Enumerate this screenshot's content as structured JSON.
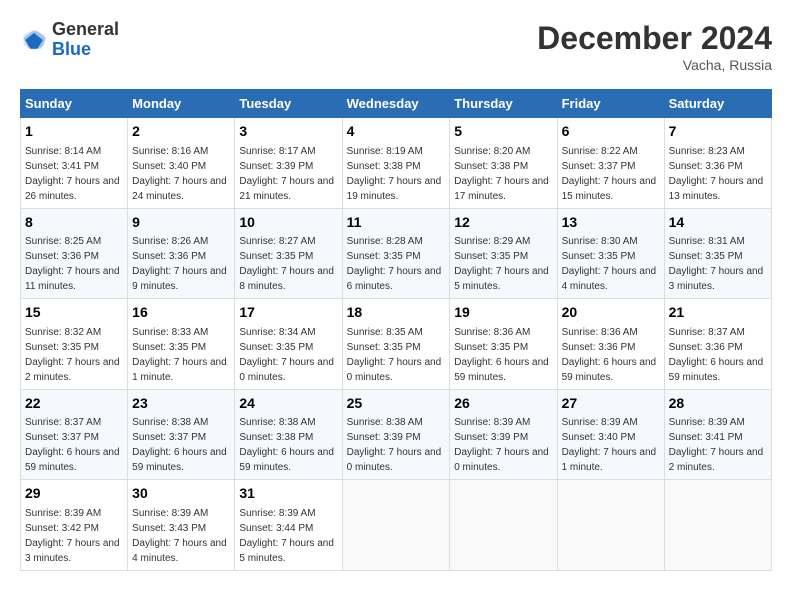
{
  "header": {
    "logo_general": "General",
    "logo_blue": "Blue",
    "month_title": "December 2024",
    "location": "Vacha, Russia"
  },
  "weekdays": [
    "Sunday",
    "Monday",
    "Tuesday",
    "Wednesday",
    "Thursday",
    "Friday",
    "Saturday"
  ],
  "weeks": [
    [
      {
        "day": "1",
        "sunrise": "Sunrise: 8:14 AM",
        "sunset": "Sunset: 3:41 PM",
        "daylight": "Daylight: 7 hours and 26 minutes."
      },
      {
        "day": "2",
        "sunrise": "Sunrise: 8:16 AM",
        "sunset": "Sunset: 3:40 PM",
        "daylight": "Daylight: 7 hours and 24 minutes."
      },
      {
        "day": "3",
        "sunrise": "Sunrise: 8:17 AM",
        "sunset": "Sunset: 3:39 PM",
        "daylight": "Daylight: 7 hours and 21 minutes."
      },
      {
        "day": "4",
        "sunrise": "Sunrise: 8:19 AM",
        "sunset": "Sunset: 3:38 PM",
        "daylight": "Daylight: 7 hours and 19 minutes."
      },
      {
        "day": "5",
        "sunrise": "Sunrise: 8:20 AM",
        "sunset": "Sunset: 3:38 PM",
        "daylight": "Daylight: 7 hours and 17 minutes."
      },
      {
        "day": "6",
        "sunrise": "Sunrise: 8:22 AM",
        "sunset": "Sunset: 3:37 PM",
        "daylight": "Daylight: 7 hours and 15 minutes."
      },
      {
        "day": "7",
        "sunrise": "Sunrise: 8:23 AM",
        "sunset": "Sunset: 3:36 PM",
        "daylight": "Daylight: 7 hours and 13 minutes."
      }
    ],
    [
      {
        "day": "8",
        "sunrise": "Sunrise: 8:25 AM",
        "sunset": "Sunset: 3:36 PM",
        "daylight": "Daylight: 7 hours and 11 minutes."
      },
      {
        "day": "9",
        "sunrise": "Sunrise: 8:26 AM",
        "sunset": "Sunset: 3:36 PM",
        "daylight": "Daylight: 7 hours and 9 minutes."
      },
      {
        "day": "10",
        "sunrise": "Sunrise: 8:27 AM",
        "sunset": "Sunset: 3:35 PM",
        "daylight": "Daylight: 7 hours and 8 minutes."
      },
      {
        "day": "11",
        "sunrise": "Sunrise: 8:28 AM",
        "sunset": "Sunset: 3:35 PM",
        "daylight": "Daylight: 7 hours and 6 minutes."
      },
      {
        "day": "12",
        "sunrise": "Sunrise: 8:29 AM",
        "sunset": "Sunset: 3:35 PM",
        "daylight": "Daylight: 7 hours and 5 minutes."
      },
      {
        "day": "13",
        "sunrise": "Sunrise: 8:30 AM",
        "sunset": "Sunset: 3:35 PM",
        "daylight": "Daylight: 7 hours and 4 minutes."
      },
      {
        "day": "14",
        "sunrise": "Sunrise: 8:31 AM",
        "sunset": "Sunset: 3:35 PM",
        "daylight": "Daylight: 7 hours and 3 minutes."
      }
    ],
    [
      {
        "day": "15",
        "sunrise": "Sunrise: 8:32 AM",
        "sunset": "Sunset: 3:35 PM",
        "daylight": "Daylight: 7 hours and 2 minutes."
      },
      {
        "day": "16",
        "sunrise": "Sunrise: 8:33 AM",
        "sunset": "Sunset: 3:35 PM",
        "daylight": "Daylight: 7 hours and 1 minute."
      },
      {
        "day": "17",
        "sunrise": "Sunrise: 8:34 AM",
        "sunset": "Sunset: 3:35 PM",
        "daylight": "Daylight: 7 hours and 0 minutes."
      },
      {
        "day": "18",
        "sunrise": "Sunrise: 8:35 AM",
        "sunset": "Sunset: 3:35 PM",
        "daylight": "Daylight: 7 hours and 0 minutes."
      },
      {
        "day": "19",
        "sunrise": "Sunrise: 8:36 AM",
        "sunset": "Sunset: 3:35 PM",
        "daylight": "Daylight: 6 hours and 59 minutes."
      },
      {
        "day": "20",
        "sunrise": "Sunrise: 8:36 AM",
        "sunset": "Sunset: 3:36 PM",
        "daylight": "Daylight: 6 hours and 59 minutes."
      },
      {
        "day": "21",
        "sunrise": "Sunrise: 8:37 AM",
        "sunset": "Sunset: 3:36 PM",
        "daylight": "Daylight: 6 hours and 59 minutes."
      }
    ],
    [
      {
        "day": "22",
        "sunrise": "Sunrise: 8:37 AM",
        "sunset": "Sunset: 3:37 PM",
        "daylight": "Daylight: 6 hours and 59 minutes."
      },
      {
        "day": "23",
        "sunrise": "Sunrise: 8:38 AM",
        "sunset": "Sunset: 3:37 PM",
        "daylight": "Daylight: 6 hours and 59 minutes."
      },
      {
        "day": "24",
        "sunrise": "Sunrise: 8:38 AM",
        "sunset": "Sunset: 3:38 PM",
        "daylight": "Daylight: 6 hours and 59 minutes."
      },
      {
        "day": "25",
        "sunrise": "Sunrise: 8:38 AM",
        "sunset": "Sunset: 3:39 PM",
        "daylight": "Daylight: 7 hours and 0 minutes."
      },
      {
        "day": "26",
        "sunrise": "Sunrise: 8:39 AM",
        "sunset": "Sunset: 3:39 PM",
        "daylight": "Daylight: 7 hours and 0 minutes."
      },
      {
        "day": "27",
        "sunrise": "Sunrise: 8:39 AM",
        "sunset": "Sunset: 3:40 PM",
        "daylight": "Daylight: 7 hours and 1 minute."
      },
      {
        "day": "28",
        "sunrise": "Sunrise: 8:39 AM",
        "sunset": "Sunset: 3:41 PM",
        "daylight": "Daylight: 7 hours and 2 minutes."
      }
    ],
    [
      {
        "day": "29",
        "sunrise": "Sunrise: 8:39 AM",
        "sunset": "Sunset: 3:42 PM",
        "daylight": "Daylight: 7 hours and 3 minutes."
      },
      {
        "day": "30",
        "sunrise": "Sunrise: 8:39 AM",
        "sunset": "Sunset: 3:43 PM",
        "daylight": "Daylight: 7 hours and 4 minutes."
      },
      {
        "day": "31",
        "sunrise": "Sunrise: 8:39 AM",
        "sunset": "Sunset: 3:44 PM",
        "daylight": "Daylight: 7 hours and 5 minutes."
      },
      null,
      null,
      null,
      null
    ]
  ]
}
